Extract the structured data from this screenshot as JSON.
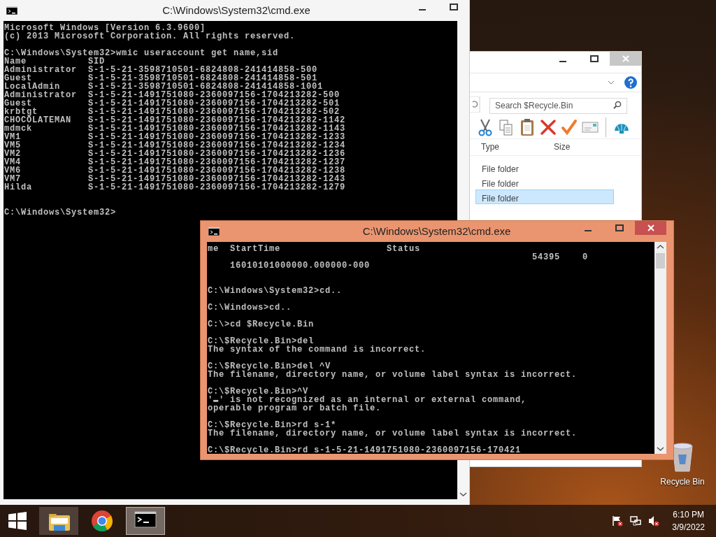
{
  "windows": [
    {
      "kind": "console",
      "title": "C:\\Windows\\System32\\cmd.exe",
      "active": false,
      "buttons": [
        {
          "kind": "minimize"
        },
        {
          "kind": "maximize"
        }
      ],
      "lines": [
        {
          "kind": "text",
          "text": "Microsoft Windows [Version 6.3.9600]"
        },
        {
          "kind": "text",
          "text": "(c) 2013 Microsoft Corporation. All rights reserved."
        },
        {
          "kind": "blank"
        },
        {
          "kind": "text",
          "text": "C:\\Windows\\System32>wmic useraccount get name,sid"
        },
        {
          "kind": "text",
          "text": "Name           SID"
        },
        {
          "kind": "text",
          "text": "Administrator  S-1-5-21-3598710501-6824808-241414858-500"
        },
        {
          "kind": "text",
          "text": "Guest          S-1-5-21-3598710501-6824808-241414858-501"
        },
        {
          "kind": "text",
          "text": "LocalAdmin     S-1-5-21-3598710501-6824808-241414858-1001"
        },
        {
          "kind": "text",
          "text": "Administrator  S-1-5-21-1491751080-2360097156-1704213282-500"
        },
        {
          "kind": "text",
          "text": "Guest          S-1-5-21-1491751080-2360097156-1704213282-501"
        },
        {
          "kind": "text",
          "text": "krbtgt         S-1-5-21-1491751080-2360097156-1704213282-502"
        },
        {
          "kind": "text",
          "text": "CHOCOLATEMAN   S-1-5-21-1491751080-2360097156-1704213282-1142"
        },
        {
          "kind": "text",
          "text": "mdmck          S-1-5-21-1491751080-2360097156-1704213282-1143"
        },
        {
          "kind": "text",
          "text": "VM1            S-1-5-21-1491751080-2360097156-1704213282-1233"
        },
        {
          "kind": "text",
          "text": "VM5            S-1-5-21-1491751080-2360097156-1704213282-1234"
        },
        {
          "kind": "text",
          "text": "VM2            S-1-5-21-1491751080-2360097156-1704213282-1236"
        },
        {
          "kind": "text",
          "text": "VM4            S-1-5-21-1491751080-2360097156-1704213282-1237"
        },
        {
          "kind": "text",
          "text": "VM6            S-1-5-21-1491751080-2360097156-1704213282-1238"
        },
        {
          "kind": "text",
          "text": "VM7            S-1-5-21-1491751080-2360097156-1704213282-1243"
        },
        {
          "kind": "text",
          "text": "Hilda          S-1-5-21-1491751080-2360097156-1704213282-1279"
        },
        {
          "kind": "blank"
        },
        {
          "kind": "blank"
        },
        {
          "kind": "text",
          "text": "C:\\Windows\\System32>"
        }
      ]
    },
    {
      "kind": "explorer",
      "active": false,
      "buttons": [
        {
          "kind": "minimize"
        },
        {
          "kind": "maximize"
        },
        {
          "kind": "close"
        }
      ],
      "search": {
        "placeholder": "Search $Recycle.Bin"
      },
      "toolbar": [
        {
          "kind": "cut"
        },
        {
          "kind": "copy"
        },
        {
          "kind": "paste"
        },
        {
          "kind": "delete"
        },
        {
          "kind": "check"
        },
        {
          "kind": "mail"
        },
        {
          "kind": "shell"
        }
      ],
      "columns": [
        "Type",
        "Size"
      ],
      "rows": [
        {
          "type": "File folder",
          "selected": false
        },
        {
          "type": "File folder",
          "selected": false
        },
        {
          "type": "File folder",
          "selected": true
        }
      ]
    },
    {
      "kind": "console",
      "title": "C:\\Windows\\System32\\cmd.exe",
      "active": true,
      "buttons": [
        {
          "kind": "minimize"
        },
        {
          "kind": "maximize"
        },
        {
          "kind": "close"
        }
      ],
      "lines": [
        {
          "kind": "text",
          "text": "me  StartTime                   Status"
        },
        {
          "kind": "text",
          "text": "                                                          54395    0"
        },
        {
          "kind": "text",
          "text": "    16010101000000.000000-000"
        },
        {
          "kind": "blank"
        },
        {
          "kind": "blank"
        },
        {
          "kind": "text",
          "text": "C:\\Windows\\System32>cd.."
        },
        {
          "kind": "blank"
        },
        {
          "kind": "text",
          "text": "C:\\Windows>cd.."
        },
        {
          "kind": "blank"
        },
        {
          "kind": "text",
          "text": "C:\\>cd $Recycle.Bin"
        },
        {
          "kind": "blank"
        },
        {
          "kind": "text",
          "text": "C:\\$Recycle.Bin>del"
        },
        {
          "kind": "text",
          "text": "The syntax of the command is incorrect."
        },
        {
          "kind": "blank"
        },
        {
          "kind": "text",
          "text": "C:\\$Recycle.Bin>del ^V"
        },
        {
          "kind": "text",
          "text": "The filename, directory name, or volume label syntax is incorrect."
        },
        {
          "kind": "blank"
        },
        {
          "kind": "text",
          "text": "C:\\$Recycle.Bin>^V"
        },
        {
          "kind": "text",
          "text": "'▬' is not recognized as an internal or external command,"
        },
        {
          "kind": "text",
          "text": "operable program or batch file."
        },
        {
          "kind": "blank"
        },
        {
          "kind": "text",
          "text": "C:\\$Recycle.Bin>rd s-1*"
        },
        {
          "kind": "text",
          "text": "The filename, directory name, or volume label syntax is incorrect."
        },
        {
          "kind": "blank"
        },
        {
          "kind": "text",
          "text": "C:\\$Recycle.Bin>rd s-1-5-21-1491751080-2360097156-170421"
        }
      ]
    }
  ],
  "desktop_icons": [
    {
      "kind": "recycle-bin",
      "label": "Recycle Bin"
    }
  ],
  "taskbar": {
    "items": [
      {
        "kind": "explorer",
        "running": true,
        "active": false
      },
      {
        "kind": "browser",
        "running": false,
        "active": false
      },
      {
        "kind": "console",
        "running": true,
        "active": true
      }
    ],
    "tray": {
      "time": "6:10 PM",
      "date": "3/9/2022"
    }
  }
}
